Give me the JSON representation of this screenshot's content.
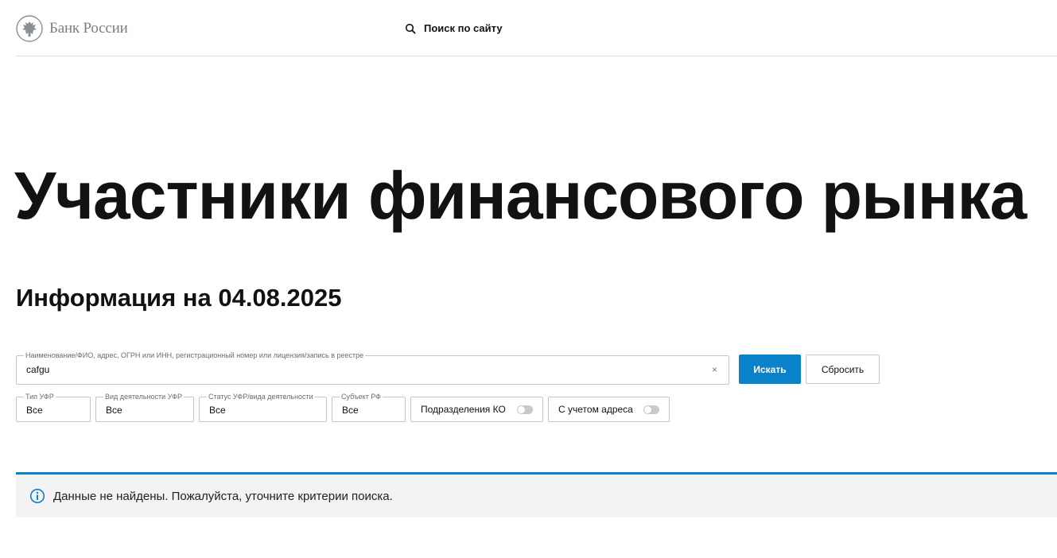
{
  "header": {
    "logo_text": "Банк России",
    "logo_icon": "eagle-emblem-icon",
    "search_icon": "search-icon",
    "search_label": "Поиск по сайту"
  },
  "page": {
    "title": "Участники финансового рынка",
    "info_date": "Информация на 04.08.2025"
  },
  "search": {
    "legend": "Наименование/ФИО, адрес, ОГРН или ИНН, регистрационный номер или лицензия/запись в реестре",
    "value": "cafgu",
    "clear_symbol": "×",
    "submit_label": "Искать",
    "reset_label": "Сбросить"
  },
  "filters": {
    "type": {
      "legend": "Тип УФР",
      "value": "Все"
    },
    "activity": {
      "legend": "Вид деятельности УФР",
      "value": "Все"
    },
    "status": {
      "legend": "Статус УФР/вида деятельности",
      "value": "Все"
    },
    "region": {
      "legend": "Субъект РФ",
      "value": "Все"
    }
  },
  "toggles": {
    "ko_divisions": {
      "label": "Подразделения КО",
      "on": false
    },
    "with_address": {
      "label": "С учетом адреса",
      "on": false
    }
  },
  "notice": {
    "icon": "info-icon",
    "text": "Данные не найдены. Пожалуйста, уточните критерии поиска."
  },
  "colors": {
    "accent": "#0a82c9",
    "notice_bg": "#f3f3f3",
    "logo_gray": "#7a7f86"
  }
}
